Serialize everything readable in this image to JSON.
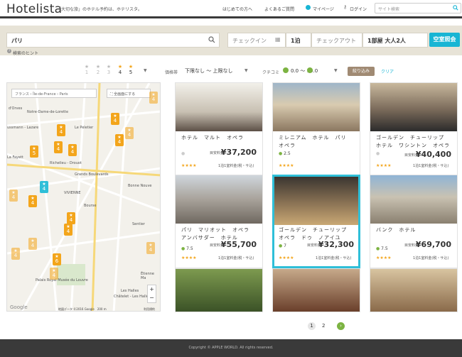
{
  "header": {
    "logo": "Hotelista",
    "tagline": "「大切な旅」のホテル予約は、ホテリスタ。",
    "nav": [
      "はじめての方へ",
      "よくあるご質問",
      "マイページ",
      "ログイン"
    ],
    "search_placeholder": "サイト検索"
  },
  "search": {
    "keyword": "パリ",
    "checkin_placeholder": "チェックイン",
    "nights": "1泊",
    "checkout_placeholder": "チェックアウト",
    "rooms": "1部屋 大人2人",
    "button": "空室照会",
    "hint": "検索のヒント"
  },
  "filters": {
    "stars": [
      "1",
      "2",
      "3",
      "4",
      "5"
    ],
    "price_label": "価格帯",
    "price_value": "下限なし 〜 上限なし",
    "review_label": "クチコミ",
    "review_value": "0.0 〜 10.0",
    "narrow": "絞り込み",
    "clear": "クリア"
  },
  "map": {
    "breadcrumb": [
      "フランス",
      "Île-de-France",
      "Paris"
    ],
    "fullscreen": "全画面にする",
    "labels": [
      "Notre-Dame-de-Lorette",
      "Le Peletier",
      "Richelieu - Drouot",
      "Grands Boulevards",
      "Bonne Nouve",
      "VIVIENNE",
      "Bourse",
      "Sentier",
      "Étienne Ma",
      "Les Halles",
      "Châtelet - Les Halles",
      "Palais Royal Musée du Louvre",
      "d'Orves",
      "ussmann - Lazare",
      "La Fayett"
    ],
    "pins": [
      "4",
      "4",
      "4",
      "4",
      "4",
      "5",
      "4",
      "4",
      "4",
      "4",
      "4",
      "4",
      "6",
      "4",
      "4",
      "4",
      "4",
      "4"
    ],
    "copyright": "地図データ ©2016 Google　200 m",
    "terms": "利用規約",
    "google": "Google",
    "zoom_in": "+",
    "zoom_out": "−"
  },
  "hotels": [
    {
      "name": "ホテル　マルト　オペラ",
      "rating": "",
      "price_label": "目安料金",
      "price": "¥37,200",
      "note": "1泊1室料金(税・サ込)",
      "stars": "★★★★"
    },
    {
      "name": "ミレニアム　ホテル　パリ　オペラ",
      "rating": "2.5",
      "price_label": "",
      "price": "",
      "note": "",
      "stars": "★★★★"
    },
    {
      "name": "ゴールデン　チューリップ　ホテル　ワシントン　オペラ",
      "rating": "",
      "price_label": "目安料金",
      "price": "¥40,400",
      "note": "1泊1室料金(税・サ込)",
      "stars": "★★★★"
    },
    {
      "name": "パリ　マリオット　オペラ　アンバサダー　ホテル",
      "rating": "7.5",
      "price_label": "目安料金",
      "price": "¥55,700",
      "note": "1泊1室料金(税・サ込)",
      "stars": "★★★★"
    },
    {
      "name": "ゴールデン　チューリップ　オペラ　ドゥ　ノアイユ",
      "rating": "7",
      "price_label": "目安料金",
      "price": "¥32,300",
      "note": "1泊1室料金(税・サ込)",
      "stars": "★★★★"
    },
    {
      "name": "バンク　ホテル",
      "rating": "7.5",
      "price_label": "目安料金",
      "price": "¥69,700",
      "note": "1泊1室料金(税・サ込)",
      "stars": "★★★★"
    }
  ],
  "pagination": [
    "1",
    "2"
  ],
  "footer": "Copyright © APPLE WORLD. All rights reserved."
}
